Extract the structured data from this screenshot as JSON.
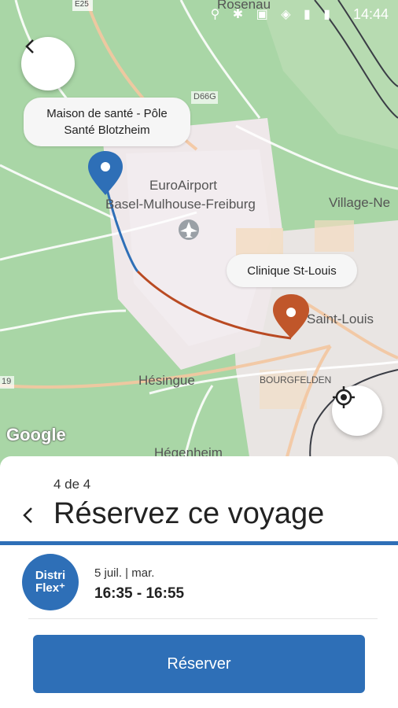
{
  "status_bar": {
    "time": "14:44",
    "icons": "⚲ ✱ ▣ ◈ ▮ ▮"
  },
  "map": {
    "labels": {
      "rosenau": "Rosenau",
      "euroairport_line1": "EuroAirport",
      "euroairport_line2": "Basel-Mulhouse-Freiburg",
      "village_neuf": "Village-Ne",
      "saint_louis": "Saint-Louis",
      "hesingue": "Hésingue",
      "bourgfelden": "BOURGFELDEN",
      "hegenheim": "Hégenheim",
      "road_e25": "E25",
      "road_d66g": "D66G",
      "road_19": "19"
    },
    "origin_label_line1": "Maison de santé - Pôle",
    "origin_label_line2": "Santé Blotzheim",
    "destination_label": "Clinique St-Louis",
    "google_logo": "Google",
    "origin_pin_color": "#2e6fb7",
    "destination_pin_color": "#c0562a"
  },
  "sheet": {
    "step": "4 de 4",
    "title": "Réservez ce voyage",
    "logo_line1": "Distri",
    "logo_line2": "Flex⁺",
    "date": "5 juil. | mar.",
    "times": "16:35 - 16:55",
    "cta": "Réserver"
  },
  "colors": {
    "primary": "#2e6fb7",
    "accent": "#c0562a"
  }
}
